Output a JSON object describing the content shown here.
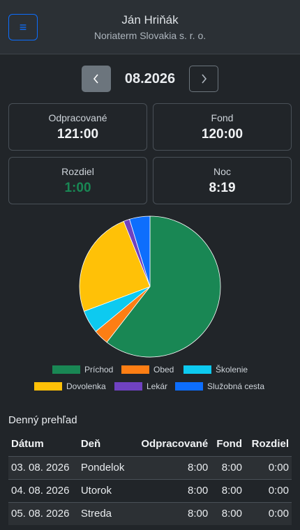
{
  "header": {
    "menu_icon": "hamburger-icon",
    "user_name": "Ján Hriňák",
    "company": "Noriaterm Slovakia s. r. o."
  },
  "nav": {
    "month": "08.2026",
    "prev_icon": "chevron-left-icon",
    "next_icon": "chevron-right-icon"
  },
  "stats": {
    "worked_label": "Odpracované",
    "worked_value": "121:00",
    "fund_label": "Fond",
    "fund_value": "120:00",
    "diff_label": "Rozdiel",
    "diff_value": "1:00",
    "night_label": "Noc",
    "night_value": "8:19"
  },
  "colors": {
    "diff_positive": "#198754",
    "accent": "#0d6efd"
  },
  "chart_data": {
    "type": "pie",
    "categories": [
      "Príchod",
      "Obed",
      "Školenie",
      "Dovolenka",
      "Lekár",
      "Služobná cesta"
    ],
    "values": [
      60.5,
      3.5,
      5.3,
      24.6,
      1.4,
      4.7
    ],
    "colors": [
      "#198754",
      "#fd7e14",
      "#0dcaf0",
      "#ffc107",
      "#6f42c1",
      "#0d6efd"
    ],
    "legend": "bottom"
  },
  "daily": {
    "title": "Denný prehľad",
    "headers": [
      "Dátum",
      "Deň",
      "Odpracované",
      "Fond",
      "Rozdiel"
    ],
    "rows": [
      [
        "03. 08. 2026",
        "Pondelok",
        "8:00",
        "8:00",
        "0:00"
      ],
      [
        "04. 08. 2026",
        "Utorok",
        "8:00",
        "8:00",
        "0:00"
      ],
      [
        "05. 08. 2026",
        "Streda",
        "8:00",
        "8:00",
        "0:00"
      ]
    ]
  }
}
